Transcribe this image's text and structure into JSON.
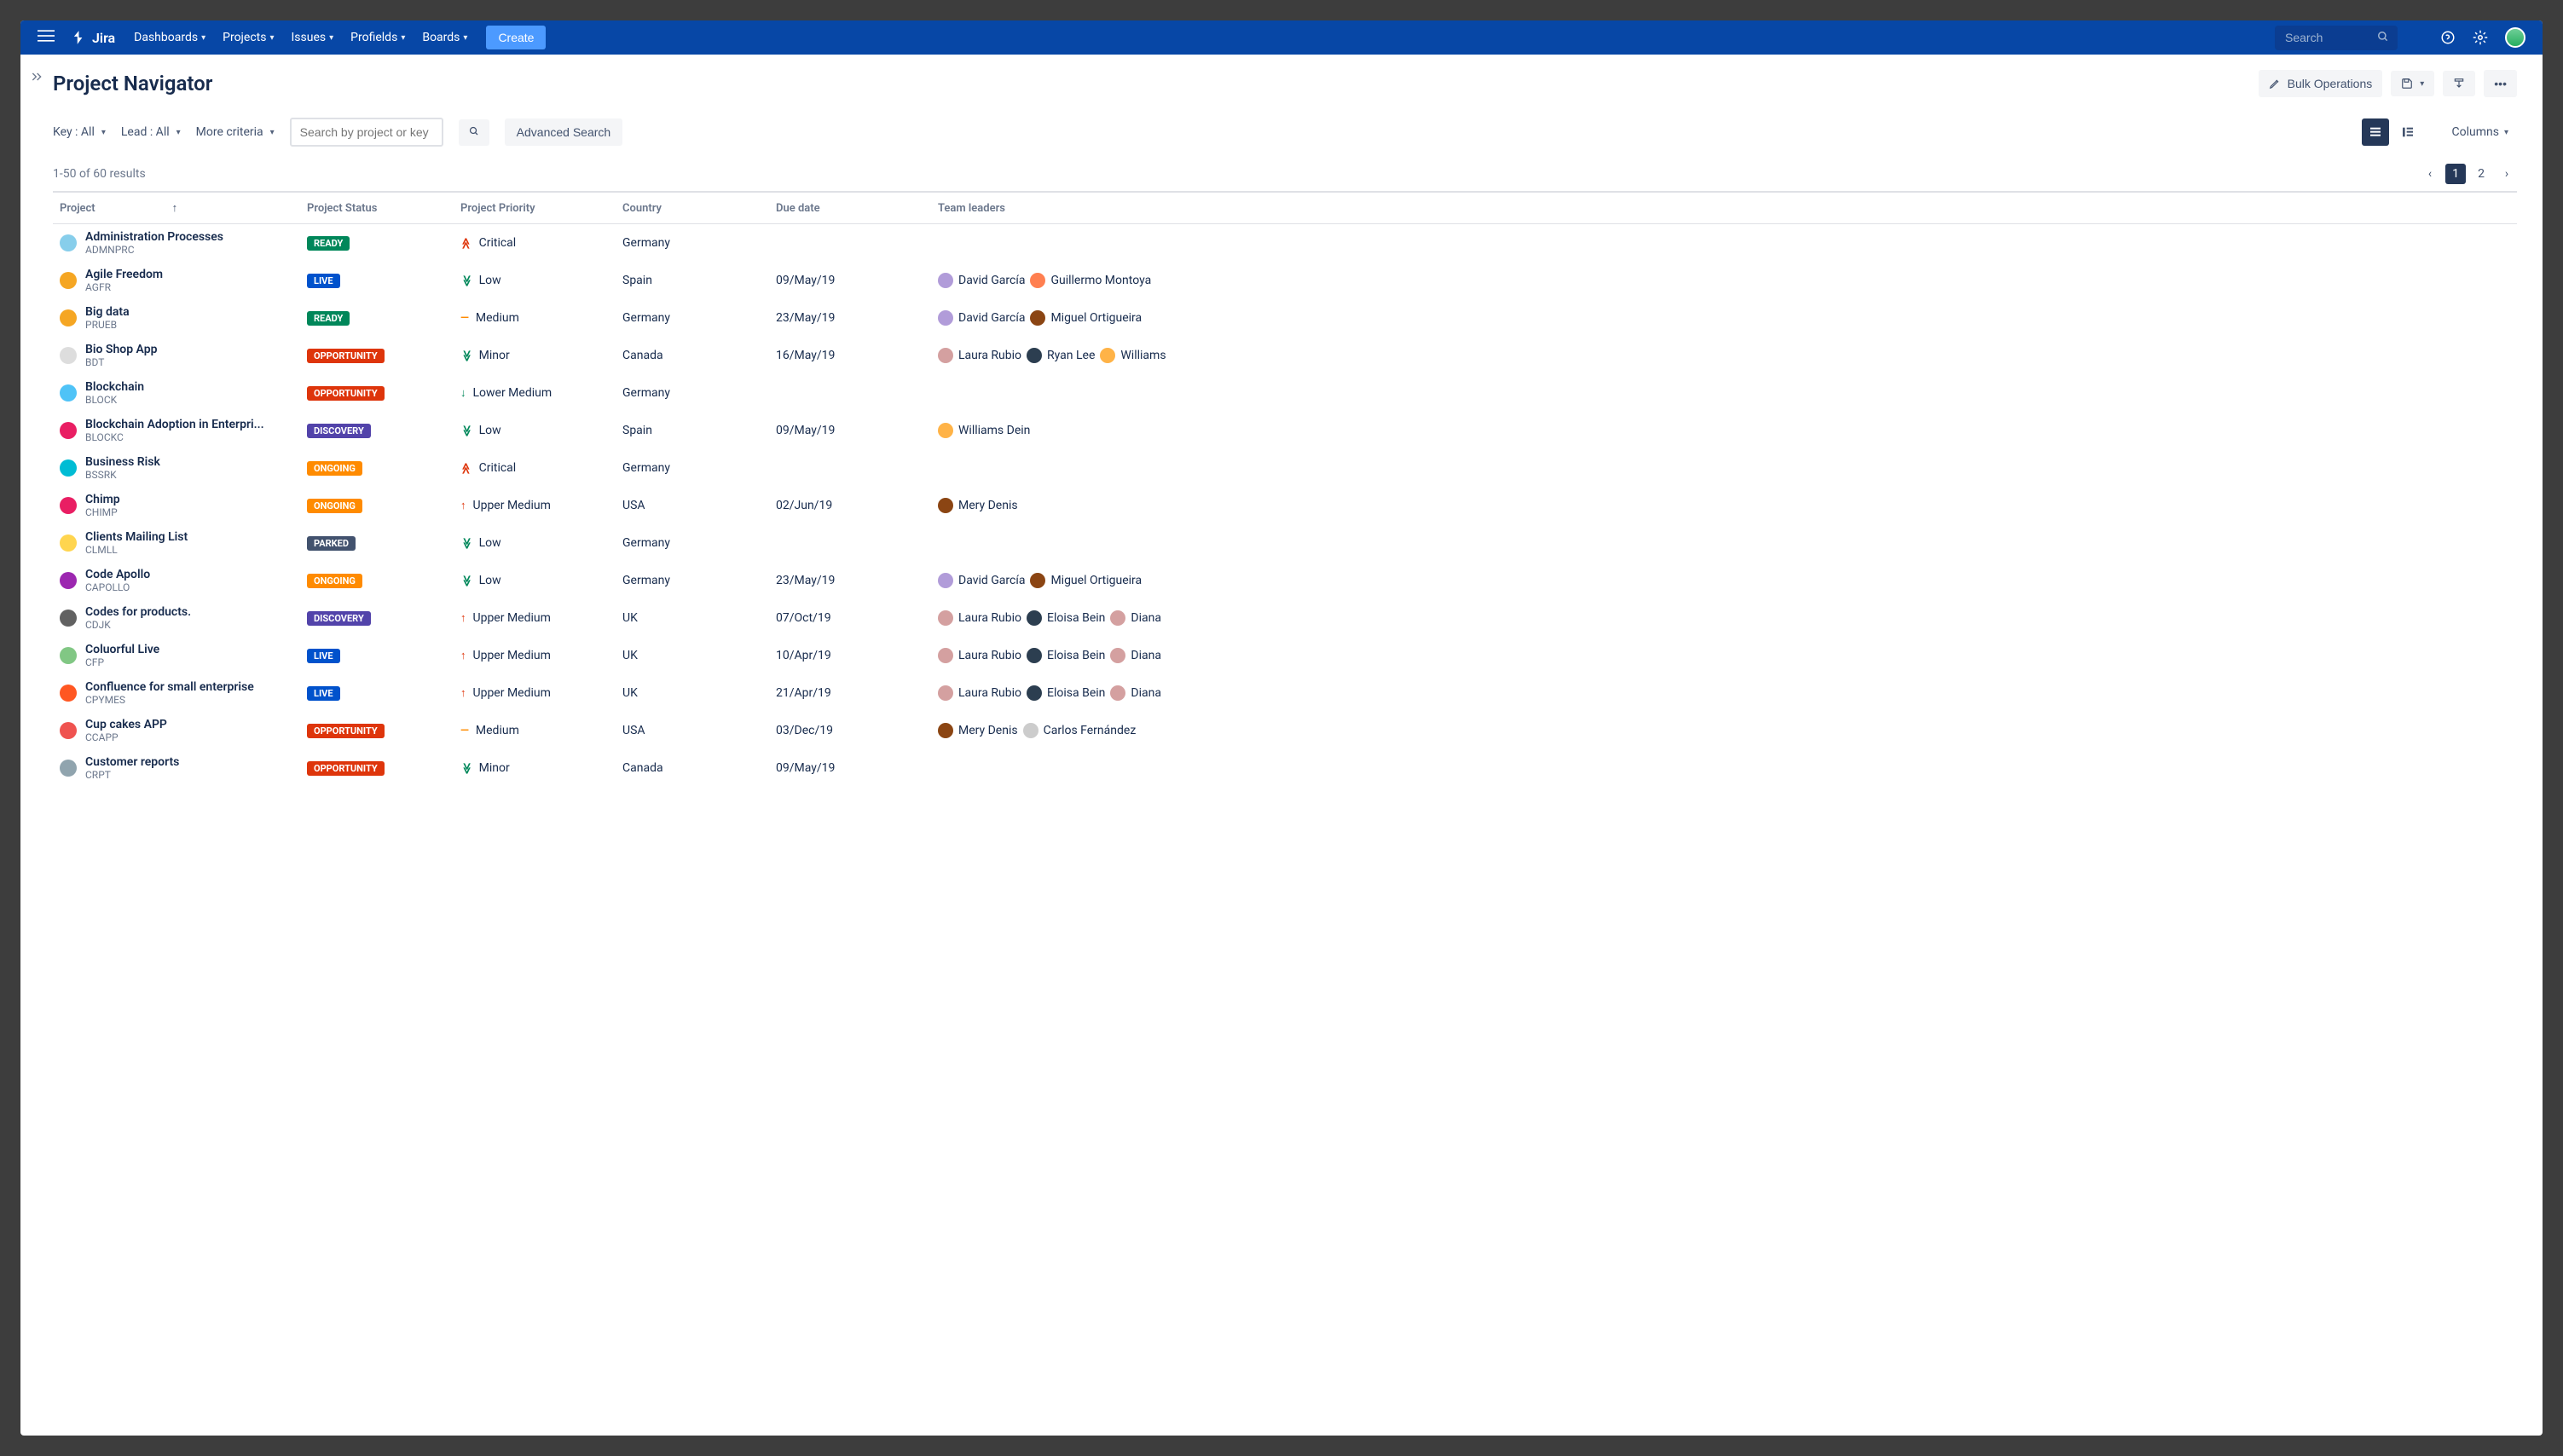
{
  "topnav": {
    "product": "Jira",
    "items": [
      "Dashboards",
      "Projects",
      "Issues",
      "Profields",
      "Boards"
    ],
    "create": "Create",
    "search_placeholder": "Search"
  },
  "header": {
    "title": "Project Navigator",
    "bulk": "Bulk Operations"
  },
  "filters": {
    "key": "Key : All",
    "lead": "Lead : All",
    "more": "More criteria",
    "search_placeholder": "Search by project or key",
    "advanced": "Advanced Search",
    "columns": "Columns"
  },
  "results": {
    "count": "1-50 of 60 results",
    "pages": [
      "1",
      "2"
    ]
  },
  "columns": [
    "Project",
    "Project Status",
    "Project Priority",
    "Country",
    "Due date",
    "Team leaders"
  ],
  "rows": [
    {
      "name": "Administration Processes",
      "key": "ADMNPRC",
      "icon": "#87CEEB",
      "status": "READY",
      "statusCls": "ready",
      "priority": "Critical",
      "prioCls": "critical",
      "prioIcon": "≫",
      "country": "Germany",
      "due": "",
      "leaders": []
    },
    {
      "name": "Agile Freedom",
      "key": "AGFR",
      "icon": "#f5a623",
      "status": "LIVE",
      "statusCls": "live",
      "priority": "Low",
      "prioCls": "low",
      "prioIcon": "≫",
      "country": "Spain",
      "due": "09/May/19",
      "leaders": [
        {
          "n": "David García",
          "c": "#b19cd9"
        },
        {
          "n": "Guillermo Montoya",
          "c": "#ff7f50"
        }
      ]
    },
    {
      "name": "Big data",
      "key": "PRUEB",
      "icon": "#f5a623",
      "status": "READY",
      "statusCls": "ready",
      "priority": "Medium",
      "prioCls": "medium",
      "prioIcon": "—",
      "country": "Germany",
      "due": "23/May/19",
      "leaders": [
        {
          "n": "David García",
          "c": "#b19cd9"
        },
        {
          "n": "Miguel Ortigueira",
          "c": "#8b4513"
        }
      ]
    },
    {
      "name": "Bio Shop App",
      "key": "BDT",
      "icon": "#ddd",
      "status": "OPPORTUNITY",
      "statusCls": "opportunity",
      "priority": "Minor",
      "prioCls": "minor",
      "prioIcon": "≫",
      "country": "Canada",
      "due": "16/May/19",
      "leaders": [
        {
          "n": "Laura Rubio",
          "c": "#d4a0a0"
        },
        {
          "n": "Ryan Lee",
          "c": "#2c3e50"
        },
        {
          "n": "Williams",
          "c": "#ffb347"
        }
      ]
    },
    {
      "name": "Blockchain",
      "key": "BLOCK",
      "icon": "#4fc3f7",
      "status": "OPPORTUNITY",
      "statusCls": "opportunity",
      "priority": "Lower Medium",
      "prioCls": "lowermedium",
      "prioIcon": "↓",
      "country": "Germany",
      "due": "",
      "leaders": []
    },
    {
      "name": "Blockchain Adoption in Enterpri...",
      "key": "BLOCKC",
      "icon": "#e91e63",
      "status": "DISCOVERY",
      "statusCls": "discovery",
      "priority": "Low",
      "prioCls": "low",
      "prioIcon": "≫",
      "country": "Spain",
      "due": "09/May/19",
      "leaders": [
        {
          "n": "Williams Dein",
          "c": "#ffb347"
        }
      ]
    },
    {
      "name": "Business Risk",
      "key": "BSSRK",
      "icon": "#00bcd4",
      "status": "ONGOING",
      "statusCls": "ongoing",
      "priority": "Critical",
      "prioCls": "critical",
      "prioIcon": "≫",
      "country": "Germany",
      "due": "",
      "leaders": []
    },
    {
      "name": "Chimp",
      "key": "CHIMP",
      "icon": "#e91e63",
      "status": "ONGOING",
      "statusCls": "ongoing",
      "priority": "Upper Medium",
      "prioCls": "uppermedium",
      "prioIcon": "↑",
      "country": "USA",
      "due": "02/Jun/19",
      "leaders": [
        {
          "n": "Mery Denis",
          "c": "#8b4513"
        }
      ]
    },
    {
      "name": "Clients Mailing List",
      "key": "CLMLL",
      "icon": "#ffd54f",
      "status": "PARKED",
      "statusCls": "parked",
      "priority": "Low",
      "prioCls": "low",
      "prioIcon": "≫",
      "country": "Germany",
      "due": "",
      "leaders": []
    },
    {
      "name": "Code Apollo",
      "key": "CAPOLLO",
      "icon": "#9c27b0",
      "status": "ONGOING",
      "statusCls": "ongoing",
      "priority": "Low",
      "prioCls": "low",
      "prioIcon": "≫",
      "country": "Germany",
      "due": "23/May/19",
      "leaders": [
        {
          "n": "David García",
          "c": "#b19cd9"
        },
        {
          "n": "Miguel Ortigueira",
          "c": "#8b4513"
        }
      ]
    },
    {
      "name": "Codes for products.",
      "key": "CDJK",
      "icon": "#616161",
      "status": "DISCOVERY",
      "statusCls": "discovery",
      "priority": "Upper Medium",
      "prioCls": "uppermedium",
      "prioIcon": "↑",
      "country": "UK",
      "due": "07/Oct/19",
      "leaders": [
        {
          "n": "Laura Rubio",
          "c": "#d4a0a0"
        },
        {
          "n": "Eloisa Bein",
          "c": "#2c3e50"
        },
        {
          "n": "Diana",
          "c": "#d4a0a0"
        }
      ]
    },
    {
      "name": "Coluorful Live",
      "key": "CFP",
      "icon": "#81c784",
      "status": "LIVE",
      "statusCls": "live",
      "priority": "Upper Medium",
      "prioCls": "uppermedium",
      "prioIcon": "↑",
      "country": "UK",
      "due": "10/Apr/19",
      "leaders": [
        {
          "n": "Laura Rubio",
          "c": "#d4a0a0"
        },
        {
          "n": "Eloisa Bein",
          "c": "#2c3e50"
        },
        {
          "n": "Diana",
          "c": "#d4a0a0"
        }
      ]
    },
    {
      "name": "Confluence for small enterprise",
      "key": "CPYMES",
      "icon": "#ff5722",
      "status": "LIVE",
      "statusCls": "live",
      "priority": "Upper Medium",
      "prioCls": "uppermedium",
      "prioIcon": "↑",
      "country": "UK",
      "due": "21/Apr/19",
      "leaders": [
        {
          "n": "Laura Rubio",
          "c": "#d4a0a0"
        },
        {
          "n": "Eloisa Bein",
          "c": "#2c3e50"
        },
        {
          "n": "Diana",
          "c": "#d4a0a0"
        }
      ]
    },
    {
      "name": "Cup cakes APP",
      "key": "CCAPP",
      "icon": "#ef5350",
      "status": "OPPORTUNITY",
      "statusCls": "opportunity",
      "priority": "Medium",
      "prioCls": "medium",
      "prioIcon": "—",
      "country": "USA",
      "due": "03/Dec/19",
      "leaders": [
        {
          "n": "Mery Denis",
          "c": "#8b4513"
        },
        {
          "n": "Carlos Fernández",
          "c": "#ccc"
        }
      ]
    },
    {
      "name": "Customer reports",
      "key": "CRPT",
      "icon": "#90a4ae",
      "status": "OPPORTUNITY",
      "statusCls": "opportunity",
      "priority": "Minor",
      "prioCls": "minor",
      "prioIcon": "≫",
      "country": "Canada",
      "due": "09/May/19",
      "leaders": []
    }
  ]
}
